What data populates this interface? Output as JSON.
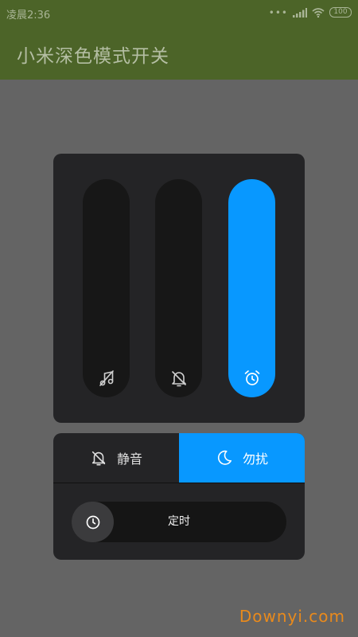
{
  "status": {
    "time": "凌晨2:36",
    "dots": "•••",
    "battery": "100",
    "signal_icon": "signal-icon",
    "wifi_icon": "wifi-icon"
  },
  "app": {
    "title": "小米深色模式开关"
  },
  "volume": {
    "sliders": [
      {
        "icon": "music-muted-icon",
        "level": 0
      },
      {
        "icon": "bell-muted-icon",
        "level": 0
      },
      {
        "icon": "alarm-clock-icon",
        "level": 1.0
      }
    ],
    "accent": "#0898ff"
  },
  "modes": {
    "silent": {
      "label": "静音",
      "icon": "bell-off-icon",
      "active": false
    },
    "dnd": {
      "label": "勿扰",
      "icon": "moon-icon",
      "active": true
    }
  },
  "timer": {
    "label": "定时",
    "icon": "clock-icon"
  },
  "watermark": "Downyi.com",
  "colors": {
    "app_bar": "#4c6428",
    "background": "#646464",
    "panel": "#242426",
    "track": "#171717",
    "accent": "#0898ff",
    "watermark": "#e98a1c"
  }
}
